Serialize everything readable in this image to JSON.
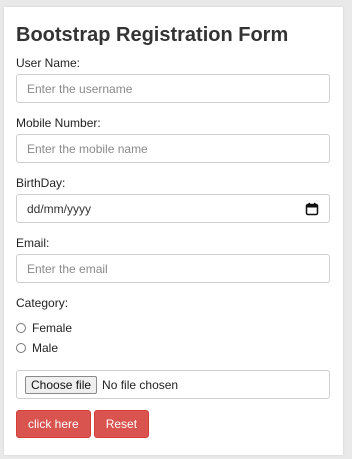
{
  "form": {
    "title": "Bootstrap Registration Form",
    "username": {
      "label": "User Name:",
      "placeholder": "Enter the username"
    },
    "mobile": {
      "label": "Mobile Number:",
      "placeholder": "Enter the mobile name"
    },
    "birthday": {
      "label": "BirthDay:",
      "value": "dd/mm/yyyy",
      "icon": "calendar-icon"
    },
    "email": {
      "label": "Email:",
      "placeholder": "Enter the email"
    },
    "category": {
      "label": "Category:",
      "options": [
        "Female",
        "Male"
      ]
    },
    "file": {
      "button_label": "Choose file",
      "status": "No file chosen"
    },
    "buttons": {
      "submit": "click here",
      "reset": "Reset"
    }
  },
  "colors": {
    "button_bg": "#d9534f",
    "page_bg": "#e9e9e9",
    "card_bg": "#ffffff"
  }
}
